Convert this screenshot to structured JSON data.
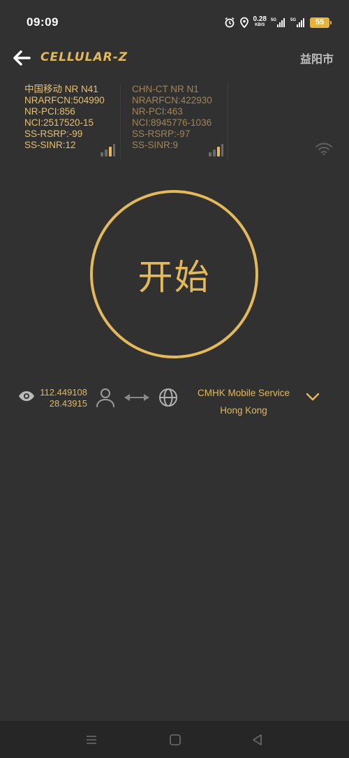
{
  "status_bar": {
    "time": "09:09",
    "speed_value": "0.28",
    "speed_unit": "KB/S",
    "network_1": "5G",
    "network_2": "5G",
    "battery": "55"
  },
  "app_bar": {
    "title": "CELLULAR-Z",
    "city": "益阳市"
  },
  "cells": [
    {
      "lines": [
        "中国移动 NR N41",
        "NRARFCN:504990",
        "NR-PCI:856",
        "NCI:2517520-15",
        "SS-RSRP:-99",
        "SS-SINR:12"
      ]
    },
    {
      "lines": [
        "CHN-CT NR N1",
        "NRARFCN:422930",
        "NR-PCI:463",
        "NCI:8945776-1036",
        "SS-RSRP:-97",
        "SS-SINR:9"
      ]
    }
  ],
  "start_button": {
    "label": "开始"
  },
  "location": {
    "longitude": "112.449108",
    "latitude": "28.43915"
  },
  "server": {
    "name": "CMHK Mobile Service",
    "location": "Hong Kong"
  },
  "colors": {
    "background": "#313131",
    "accent": "#e3b95a",
    "secondary_text": "#a18654",
    "nav_bar": "#262626"
  },
  "icons": {
    "back": "arrow-left-icon",
    "signal": "signal-bars-icon",
    "wifi": "wifi-icon",
    "eye": "eye-icon",
    "person": "person-icon",
    "transfer": "double-arrow-icon",
    "globe": "globe-icon",
    "dropdown": "chevron-down-icon"
  }
}
